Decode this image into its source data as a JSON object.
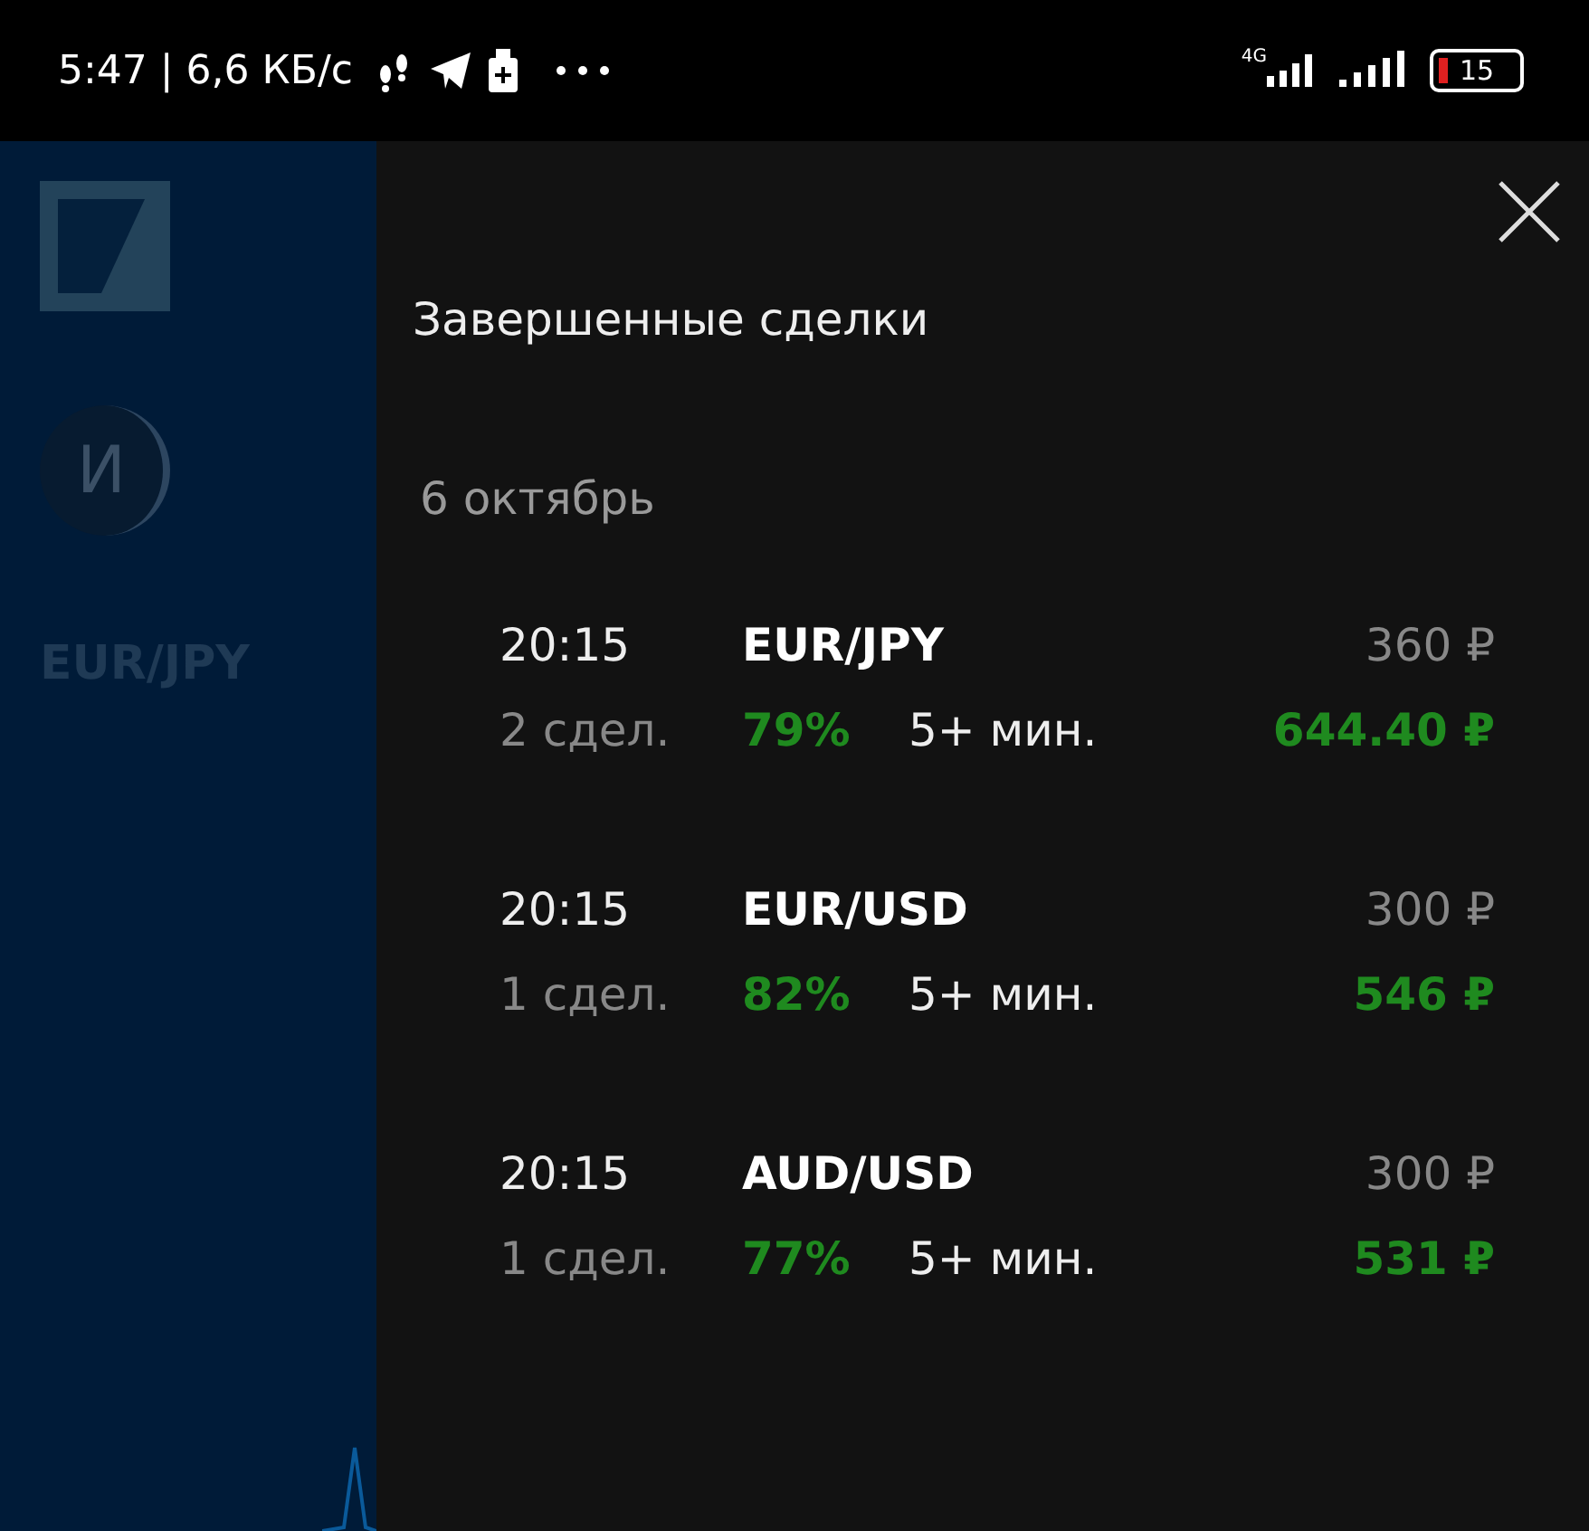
{
  "status_bar": {
    "time_speed": "5:47 | 6,6 КБ/с",
    "network": "4G",
    "battery": "15"
  },
  "background": {
    "avatar_letter": "И",
    "pair": "EUR/JPY"
  },
  "panel": {
    "title": "Завершенные сделки",
    "date": "6 октябрь",
    "trades": [
      {
        "time": "20:15",
        "pair": "EUR/JPY",
        "stake": "360 ₽",
        "count": "2 сдел.",
        "percent": "79%",
        "duration": "5+ мин.",
        "payout": "644.40 ₽"
      },
      {
        "time": "20:15",
        "pair": "EUR/USD",
        "stake": "300 ₽",
        "count": "1 сдел.",
        "percent": "82%",
        "duration": "5+ мин.",
        "payout": "546 ₽"
      },
      {
        "time": "20:15",
        "pair": "AUD/USD",
        "stake": "300 ₽",
        "count": "1 сдел.",
        "percent": "77%",
        "duration": "5+ мин.",
        "payout": "531 ₽"
      }
    ]
  }
}
